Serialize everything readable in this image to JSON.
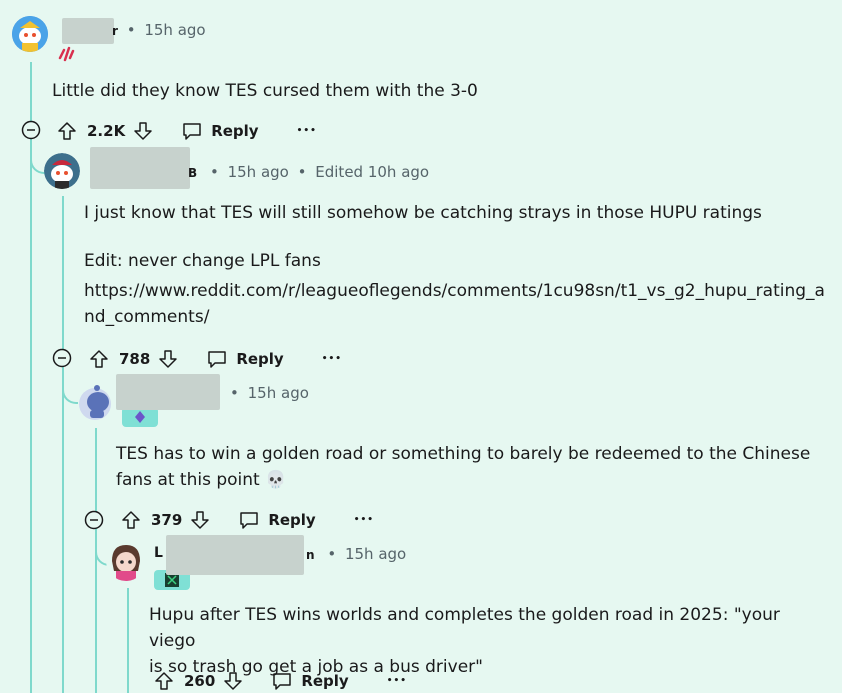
{
  "comments": [
    {
      "username_fragment": "r",
      "time": "15h ago",
      "edited": "",
      "text_lines": [
        "Little did they know TES cursed them with the 3-0"
      ],
      "votes": "2.2K",
      "reply_label": "Reply"
    },
    {
      "username_fragment": "B",
      "time": "15h ago",
      "edited": "Edited 10h ago",
      "text_lines": [
        "I just know that TES will still somehow be catching strays in those HUPU ratings",
        "Edit: never change LPL fans",
        "https://www.reddit.com/r/leagueoflegends/comments/1cu98sn/t1_vs_g2_hupu_rating_a",
        "nd_comments/"
      ],
      "votes": "788",
      "reply_label": "Reply"
    },
    {
      "username_fragment": "",
      "time": "15h ago",
      "edited": "",
      "text_lines": [
        "TES has to win a golden road or something to barely be redeemed to the Chinese",
        "fans at this point 💀"
      ],
      "votes": "379",
      "reply_label": "Reply"
    },
    {
      "username_fragment_start": "L",
      "username_fragment_end": "n",
      "time": "15h ago",
      "edited": "",
      "text_lines": [
        "Hupu after TES wins worlds and completes the golden road in 2025: \"your viego",
        "is so trash go get a job as a bus driver\""
      ],
      "votes": "260",
      "reply_label": "Reply"
    }
  ],
  "separator": "•",
  "more_label": "•••",
  "colors": {
    "background": "#e6f8f1",
    "thread_line": "#7fd9cc",
    "meta_text": "#56646a",
    "text": "#1a1a1b"
  }
}
